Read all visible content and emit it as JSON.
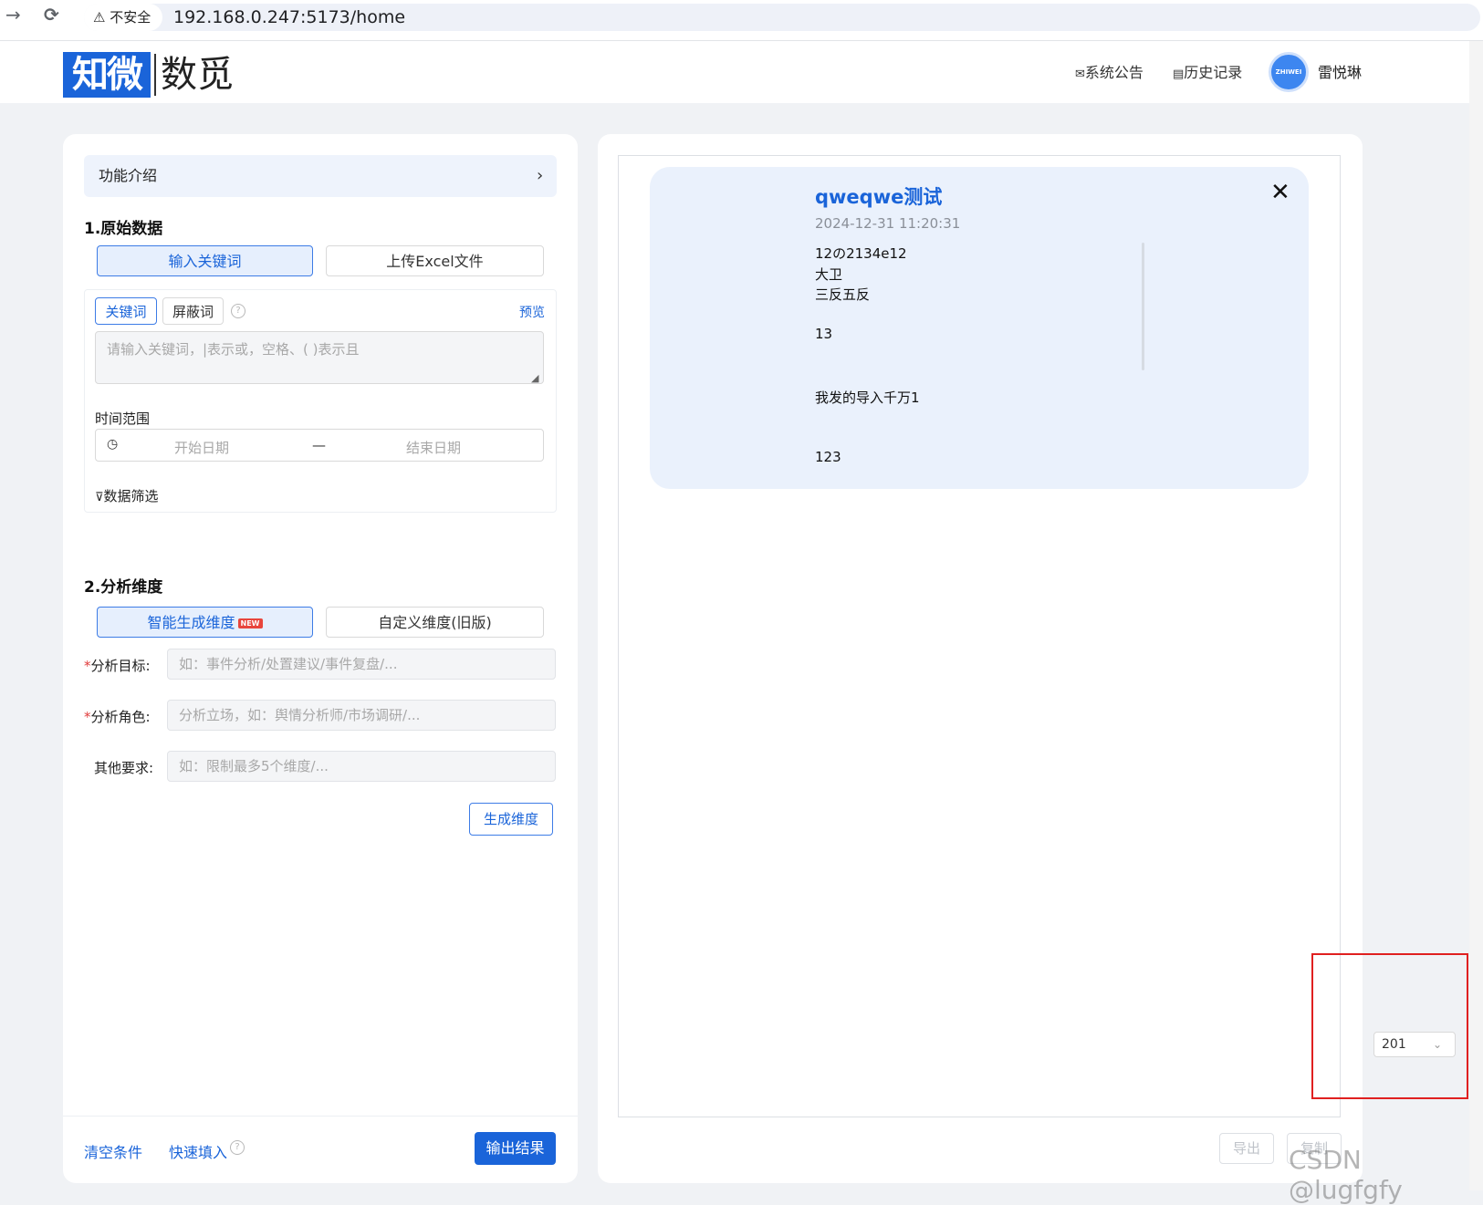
{
  "browser": {
    "back_glyph": "→",
    "reload_glyph": "C",
    "security_label": "不安全",
    "url": "192.168.0.247:5173/home"
  },
  "header": {
    "logo_mark": "知微",
    "logo_text": "数觅",
    "announce_label": "系统公告",
    "history_label": "历史记录",
    "avatar_text": "ZHIWEI",
    "username": "雷悦琳"
  },
  "left": {
    "intro_label": "功能介绍",
    "section1_title": "1.原始数据",
    "source_tabs": [
      "输入关键词",
      "上传Excel文件"
    ],
    "kw_tabs": [
      "关键词",
      "屏蔽词"
    ],
    "preview_label": "预览",
    "kw_placeholder": "请输入关键词，|表示或，空格、( )表示且",
    "time_label": "时间范围",
    "start_placeholder": "开始日期",
    "date_sep": "—",
    "end_placeholder": "结束日期",
    "filter_label": "数据筛选",
    "section2_title": "2.分析维度",
    "dim_tabs": [
      "智能生成维度",
      "自定义维度(旧版)"
    ],
    "new_badge": "NEW",
    "fields": [
      {
        "label": "分析目标:",
        "required": "*",
        "placeholder": "如：事件分析/处置建议/事件复盘/..."
      },
      {
        "label": "分析角色:",
        "required": "*",
        "placeholder": "分析立场，如：舆情分析师/市场调研/..."
      },
      {
        "label": "其他要求:",
        "required": "",
        "placeholder": "如：限制最多5个维度/..."
      }
    ],
    "generate_label": "生成维度",
    "clear_label": "清空条件",
    "quick_fill_label": "快速填入",
    "output_label": "输出结果"
  },
  "result": {
    "title": "qweqwe测试",
    "time": "2024-12-31 11:20:31",
    "lines": [
      "12の2134e12",
      "大卫",
      "三反五反",
      "13",
      "我发的导入千万1",
      "123"
    ],
    "close_glyph": "✕"
  },
  "right_footer": {
    "export_label": "导出",
    "copy_label": "复制"
  },
  "floating_select": {
    "value": "201"
  },
  "watermark": "CSDN @lugfgfy",
  "colors": {
    "primary": "#1a64d9",
    "required": "#e03b3b",
    "highlight_box": "#e02020"
  }
}
